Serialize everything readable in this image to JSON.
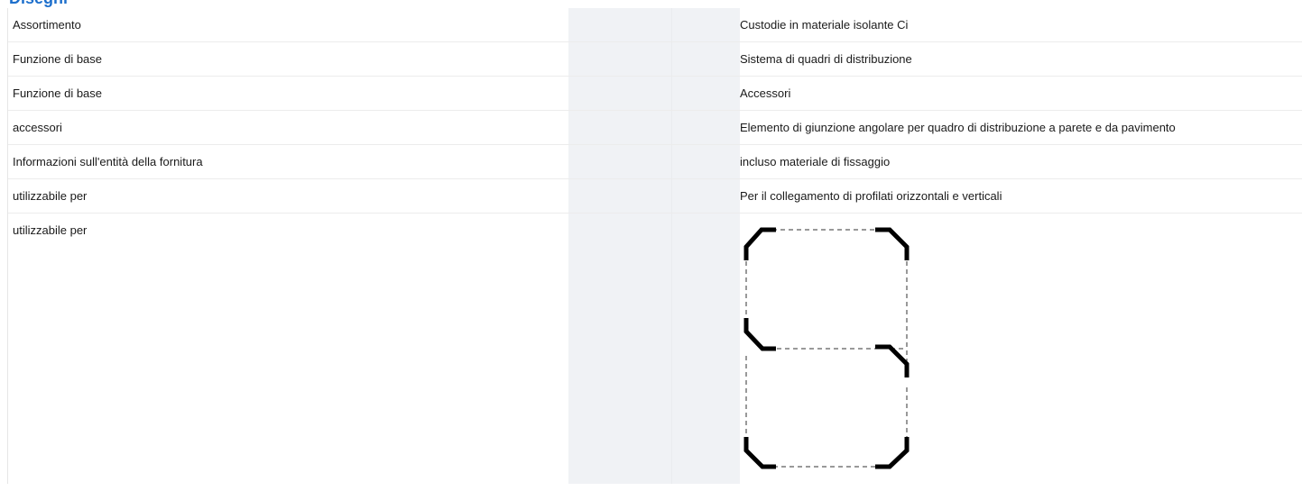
{
  "section": {
    "title": "Disegni"
  },
  "rows": [
    {
      "label": "Assortimento",
      "value": "Custodie in materiale isolante Ci"
    },
    {
      "label": "Funzione di base",
      "value": "Sistema di quadri di distribuzione"
    },
    {
      "label": "Funzione di base",
      "value": "Accessori"
    },
    {
      "label": "accessori",
      "value": "Elemento di giunzione angolare per quadro di distribuzione a parete e da pavimento"
    },
    {
      "label": "Informazioni sull'entità della fornitura",
      "value": "incluso materiale di fissaggio"
    },
    {
      "label": "utilizzabile per",
      "value": "Per il collegamento di profilati orizzontali e verticali"
    },
    {
      "label": "utilizzabile per",
      "value": ""
    }
  ],
  "colors": {
    "heading": "#1d6fcc",
    "shaded_column": "#f0f2f5",
    "row_border": "#ececec",
    "drawing_stroke": "#000000"
  },
  "drawing": {
    "icon": "corner-joint-drawing-icon"
  }
}
